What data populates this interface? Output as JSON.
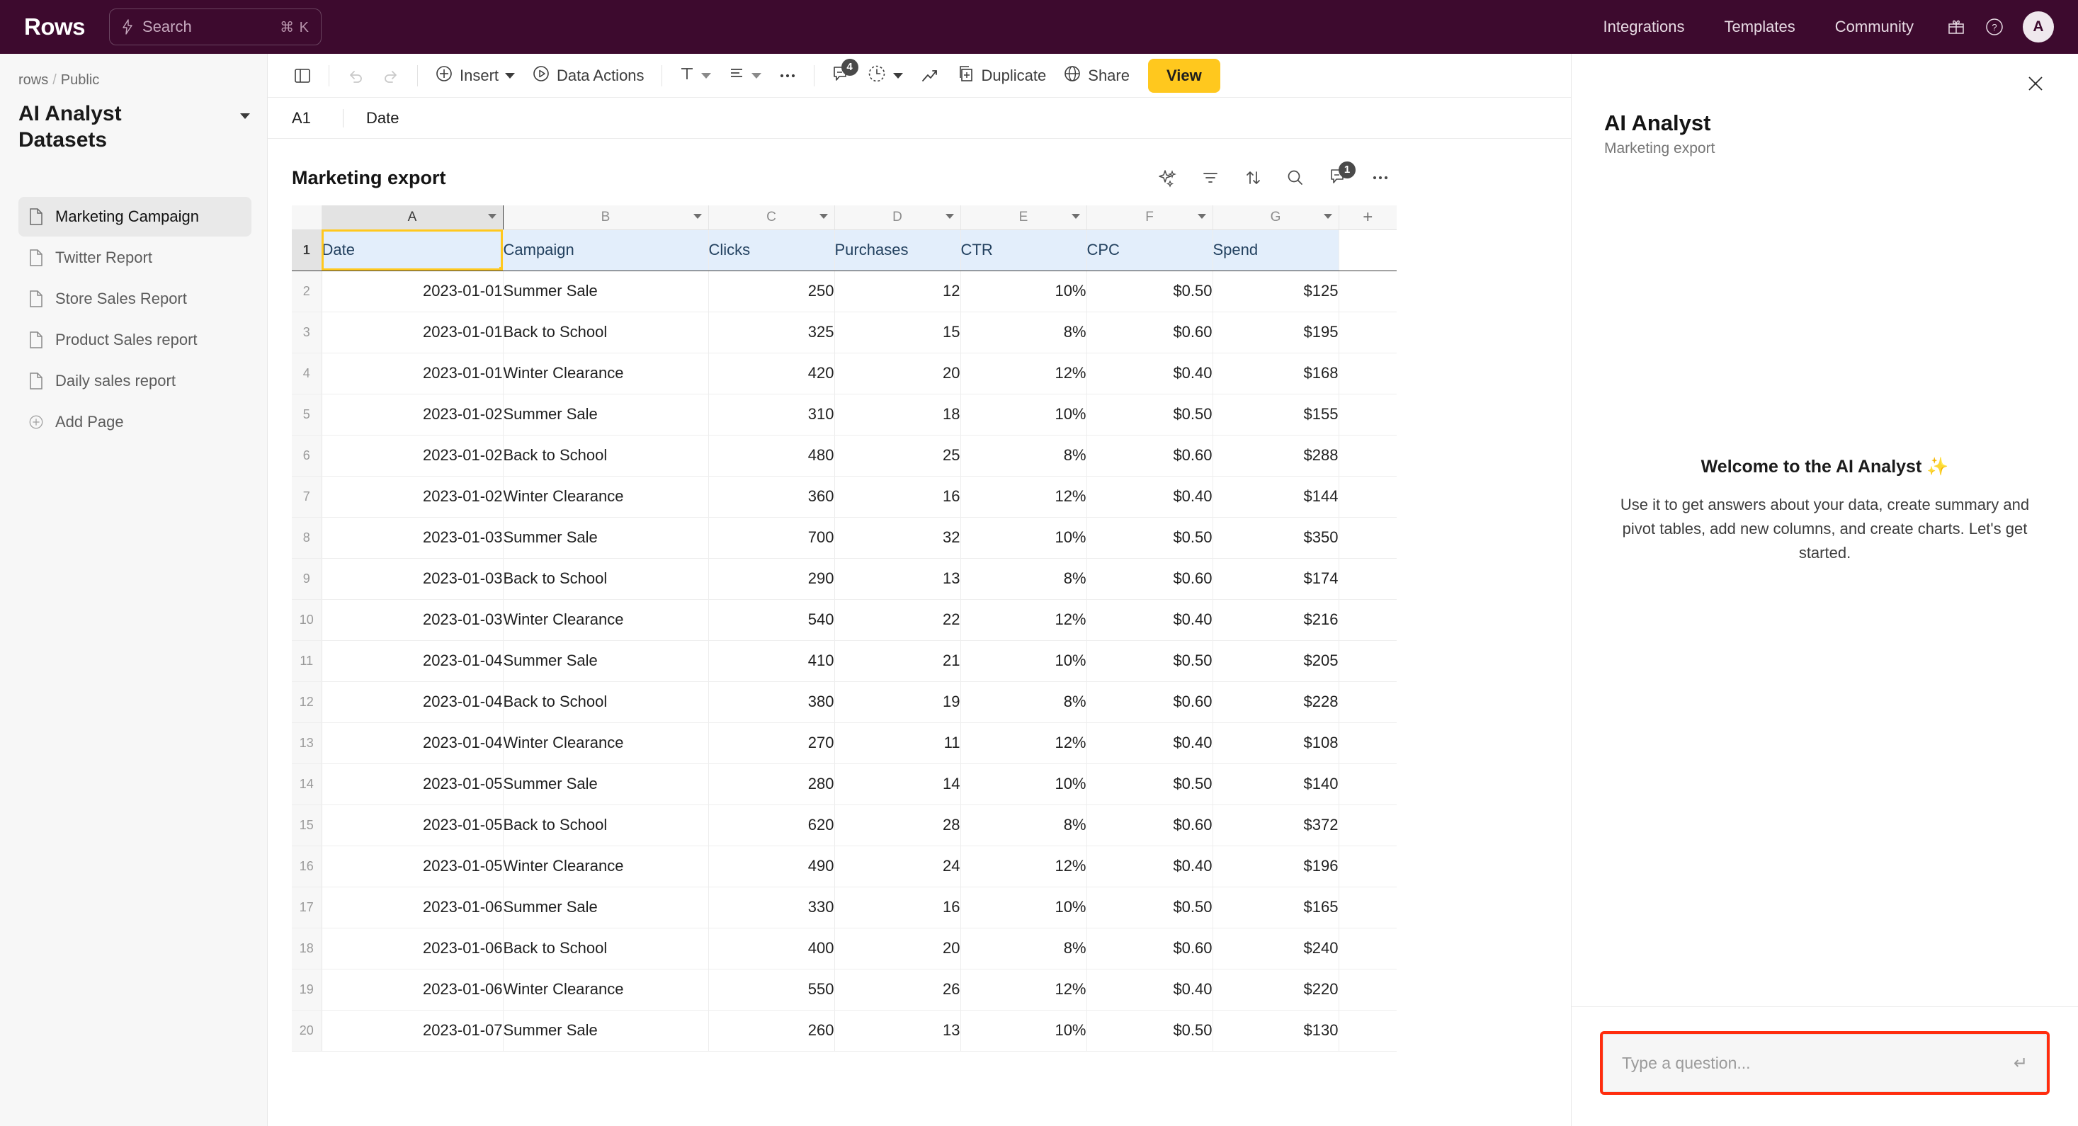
{
  "topbar": {
    "brand": "Rows",
    "search_placeholder": "Search",
    "search_shortcut": "⌘ K",
    "nav": [
      {
        "label": "Integrations"
      },
      {
        "label": "Templates"
      },
      {
        "label": "Community"
      }
    ],
    "avatar_initial": "A"
  },
  "sidebar": {
    "breadcrumb": {
      "root": "rows",
      "sep": "/",
      "current": "Public"
    },
    "workspace_title": "AI Analyst Datasets",
    "pages": [
      {
        "label": "Marketing Campaign",
        "active": true
      },
      {
        "label": "Twitter Report",
        "active": false
      },
      {
        "label": "Store Sales Report",
        "active": false
      },
      {
        "label": "Product Sales report",
        "active": false
      },
      {
        "label": "Daily sales report",
        "active": false
      }
    ],
    "add_page_label": "Add Page"
  },
  "toolbar": {
    "insert_label": "Insert",
    "data_actions_label": "Data Actions",
    "duplicate_label": "Duplicate",
    "share_label": "Share",
    "view_label": "View",
    "comments_badge": "4"
  },
  "formula_bar": {
    "cell_ref": "A1",
    "value": "Date"
  },
  "sheet": {
    "title": "Marketing export",
    "comments_badge": "1",
    "add_column_label": "+",
    "column_letters": [
      "A",
      "B",
      "C",
      "D",
      "E",
      "F",
      "G"
    ],
    "selected_column": "A",
    "selected_cell": "A1",
    "headers": [
      "Date",
      "Campaign",
      "Clicks",
      "Purchases",
      "CTR",
      "CPC",
      "Spend"
    ],
    "rows": [
      {
        "n": "2",
        "cells": [
          "2023-01-01",
          "Summer Sale",
          "250",
          "12",
          "10%",
          "$0.50",
          "$125"
        ]
      },
      {
        "n": "3",
        "cells": [
          "2023-01-01",
          "Back to School",
          "325",
          "15",
          "8%",
          "$0.60",
          "$195"
        ]
      },
      {
        "n": "4",
        "cells": [
          "2023-01-01",
          "Winter Clearance",
          "420",
          "20",
          "12%",
          "$0.40",
          "$168"
        ]
      },
      {
        "n": "5",
        "cells": [
          "2023-01-02",
          "Summer Sale",
          "310",
          "18",
          "10%",
          "$0.50",
          "$155"
        ]
      },
      {
        "n": "6",
        "cells": [
          "2023-01-02",
          "Back to School",
          "480",
          "25",
          "8%",
          "$0.60",
          "$288"
        ]
      },
      {
        "n": "7",
        "cells": [
          "2023-01-02",
          "Winter Clearance",
          "360",
          "16",
          "12%",
          "$0.40",
          "$144"
        ]
      },
      {
        "n": "8",
        "cells": [
          "2023-01-03",
          "Summer Sale",
          "700",
          "32",
          "10%",
          "$0.50",
          "$350"
        ]
      },
      {
        "n": "9",
        "cells": [
          "2023-01-03",
          "Back to School",
          "290",
          "13",
          "8%",
          "$0.60",
          "$174"
        ]
      },
      {
        "n": "10",
        "cells": [
          "2023-01-03",
          "Winter Clearance",
          "540",
          "22",
          "12%",
          "$0.40",
          "$216"
        ]
      },
      {
        "n": "11",
        "cells": [
          "2023-01-04",
          "Summer Sale",
          "410",
          "21",
          "10%",
          "$0.50",
          "$205"
        ]
      },
      {
        "n": "12",
        "cells": [
          "2023-01-04",
          "Back to School",
          "380",
          "19",
          "8%",
          "$0.60",
          "$228"
        ]
      },
      {
        "n": "13",
        "cells": [
          "2023-01-04",
          "Winter Clearance",
          "270",
          "11",
          "12%",
          "$0.40",
          "$108"
        ]
      },
      {
        "n": "14",
        "cells": [
          "2023-01-05",
          "Summer Sale",
          "280",
          "14",
          "10%",
          "$0.50",
          "$140"
        ]
      },
      {
        "n": "15",
        "cells": [
          "2023-01-05",
          "Back to School",
          "620",
          "28",
          "8%",
          "$0.60",
          "$372"
        ]
      },
      {
        "n": "16",
        "cells": [
          "2023-01-05",
          "Winter Clearance",
          "490",
          "24",
          "12%",
          "$0.40",
          "$196"
        ]
      },
      {
        "n": "17",
        "cells": [
          "2023-01-06",
          "Summer Sale",
          "330",
          "16",
          "10%",
          "$0.50",
          "$165"
        ]
      },
      {
        "n": "18",
        "cells": [
          "2023-01-06",
          "Back to School",
          "400",
          "20",
          "8%",
          "$0.60",
          "$240"
        ]
      },
      {
        "n": "19",
        "cells": [
          "2023-01-06",
          "Winter Clearance",
          "550",
          "26",
          "12%",
          "$0.40",
          "$220"
        ]
      },
      {
        "n": "20",
        "cells": [
          "2023-01-07",
          "Summer Sale",
          "260",
          "13",
          "10%",
          "$0.50",
          "$130"
        ]
      }
    ]
  },
  "ai_panel": {
    "title": "AI Analyst",
    "subtitle": "Marketing export",
    "welcome_heading": "Welcome to the AI Analyst ✨",
    "welcome_body": "Use it to get answers about your data, create summary and pivot tables, add new columns, and create charts. Let's get started.",
    "input_placeholder": "Type a question...",
    "enter_glyph": "↵"
  },
  "colors": {
    "topbar_bg": "#3d0a2e",
    "accent_yellow": "#ffc81e",
    "highlight_red": "#ff2d0e",
    "header_row_blue": "#e3eefb"
  }
}
